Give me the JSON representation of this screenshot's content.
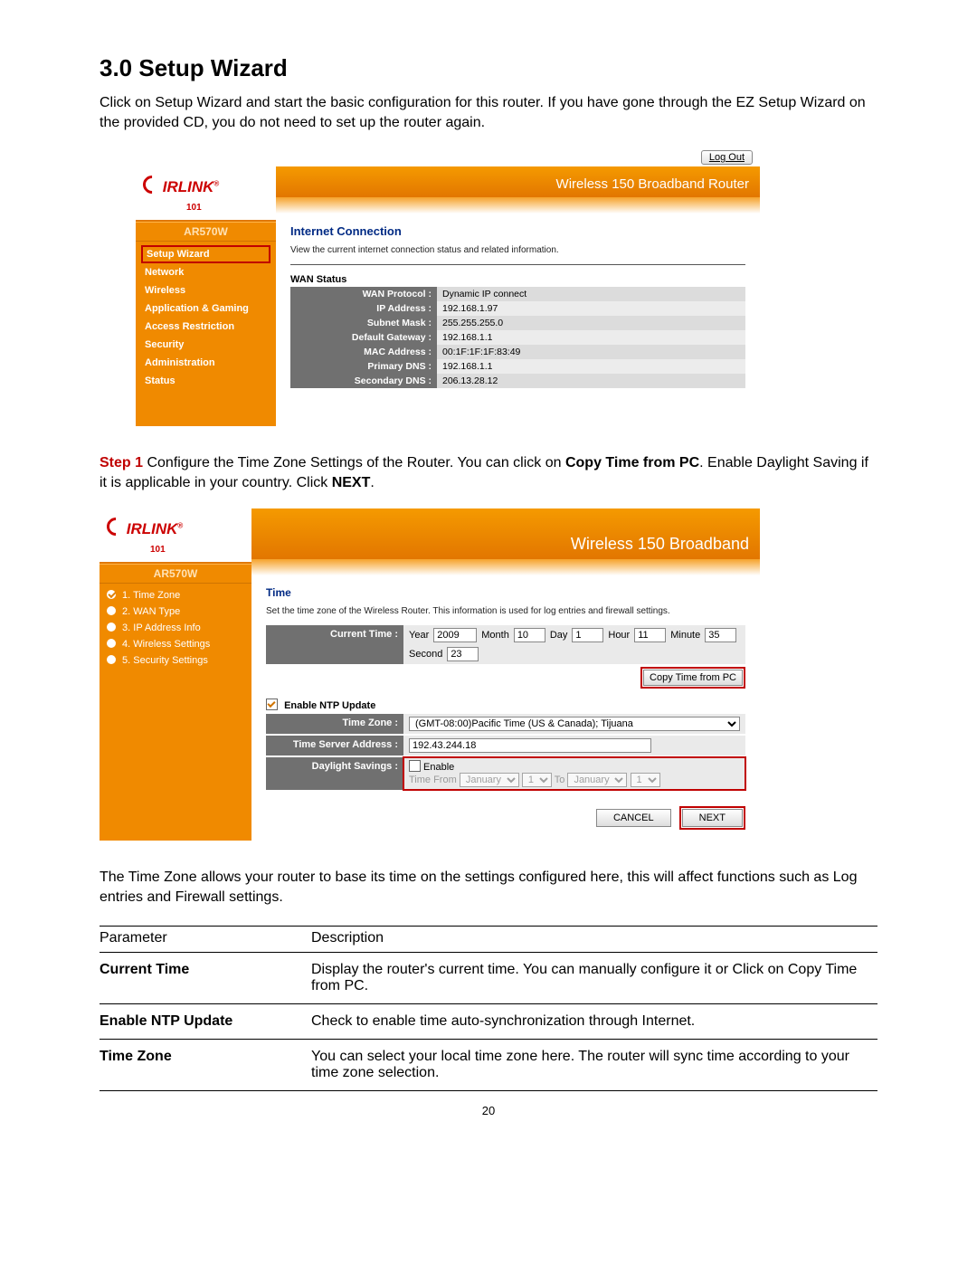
{
  "heading": "3.0 Setup Wizard",
  "intro": "Click on Setup Wizard and start the basic configuration for this router. If you have gone through the EZ Setup Wizard on the provided CD, you do not need to set up the router again.",
  "logout_label": "Log Out",
  "banner_title": "Wireless 150 Broadband Router",
  "banner_title2": "Wireless 150 Broadband",
  "logo_text": "IRLINK",
  "logo_sub": "101",
  "model": "AR570W",
  "nav_items": [
    "Setup Wizard",
    "Network",
    "Wireless",
    "Application & Gaming",
    "Access Restriction",
    "Security",
    "Administration",
    "Status"
  ],
  "shot1": {
    "title": "Internet Connection",
    "desc": "View the current internet connection status and related information.",
    "wan_title": "WAN Status",
    "rows": [
      {
        "k": "WAN Protocol :",
        "v": "Dynamic IP connect"
      },
      {
        "k": "IP Address :",
        "v": "192.168.1.97"
      },
      {
        "k": "Subnet Mask :",
        "v": "255.255.255.0"
      },
      {
        "k": "Default Gateway :",
        "v": "192.168.1.1"
      },
      {
        "k": "MAC Address :",
        "v": "00:1F:1F:1F:83:49"
      },
      {
        "k": "Primary DNS :",
        "v": "192.168.1.1"
      },
      {
        "k": "Secondary DNS :",
        "v": "206.13.28.12"
      }
    ]
  },
  "step1_label": "Step 1",
  "step1": " Configure the Time Zone Settings of the Router. You can click on ",
  "step1_bold1": "Copy Time from PC",
  "step1_after": ". Enable Daylight Saving if it is applicable in your country. Click ",
  "step1_bold2": "NEXT",
  "step1_end": ".",
  "wizard_steps": [
    "1. Time Zone",
    "2. WAN Type",
    "3. IP Address Info",
    "4. Wireless Settings",
    "5. Security Settings"
  ],
  "shot2": {
    "title": "Time",
    "desc": "Set the time zone of the Wireless Router. This information is used for log entries and firewall settings.",
    "current_time_label": "Current Time :",
    "year_l": "Year",
    "year_v": "2009",
    "month_l": "Month",
    "month_v": "10",
    "day_l": "Day",
    "day_v": "1",
    "hour_l": "Hour",
    "hour_v": "11",
    "min_l": "Minute",
    "min_v": "35",
    "sec_l": "Second",
    "sec_v": "23",
    "copy_btn": "Copy Time from PC",
    "ntp_label": "Enable NTP Update",
    "tz_label": "Time Zone :",
    "tz_value": "(GMT-08:00)Pacific Time (US & Canada); Tijuana",
    "ts_label": "Time Server Address :",
    "ts_value": "192.43.244.18",
    "dl_label": "Daylight Savings :",
    "dl_enable": "Enable",
    "dl_from": "Time From",
    "dl_to": "To",
    "dl_month": "January",
    "dl_day": "1",
    "cancel": "CANCEL",
    "next": "NEXT"
  },
  "body2": "The Time Zone allows your router to base its time on the settings configured here, this will affect functions such as Log entries and Firewall settings.",
  "param_header": {
    "p": "Parameter",
    "d": "Description"
  },
  "params": [
    {
      "p": "Current Time",
      "d": "Display the router's current time. You can manually configure it or Click on Copy Time from PC."
    },
    {
      "p": "Enable NTP Update",
      "d": "Check to enable time auto-synchronization through Internet."
    },
    {
      "p": "Time Zone",
      "d": "You can select your local time zone here. The router will sync time according to your time zone selection."
    }
  ],
  "page_number": "20"
}
